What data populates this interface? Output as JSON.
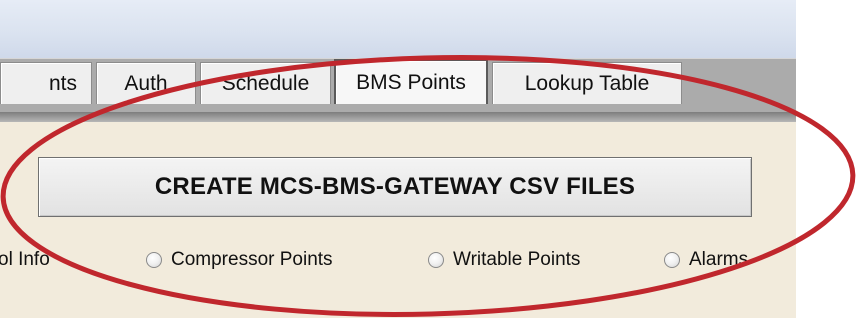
{
  "tabs": [
    {
      "label": "nts"
    },
    {
      "label": "Auth"
    },
    {
      "label": "Schedule"
    },
    {
      "label": "BMS Points",
      "selected": true
    },
    {
      "label": "Lookup Table"
    }
  ],
  "main": {
    "create_button_label": "CREATE MCS-BMS-GATEWAY CSV FILES"
  },
  "radios": [
    {
      "label": "ol Info"
    },
    {
      "label": "Compressor Points"
    },
    {
      "label": "Writable Points"
    },
    {
      "label": "Alarms"
    }
  ],
  "annotation": {
    "shape": "ellipse",
    "color": "#c0272d"
  }
}
